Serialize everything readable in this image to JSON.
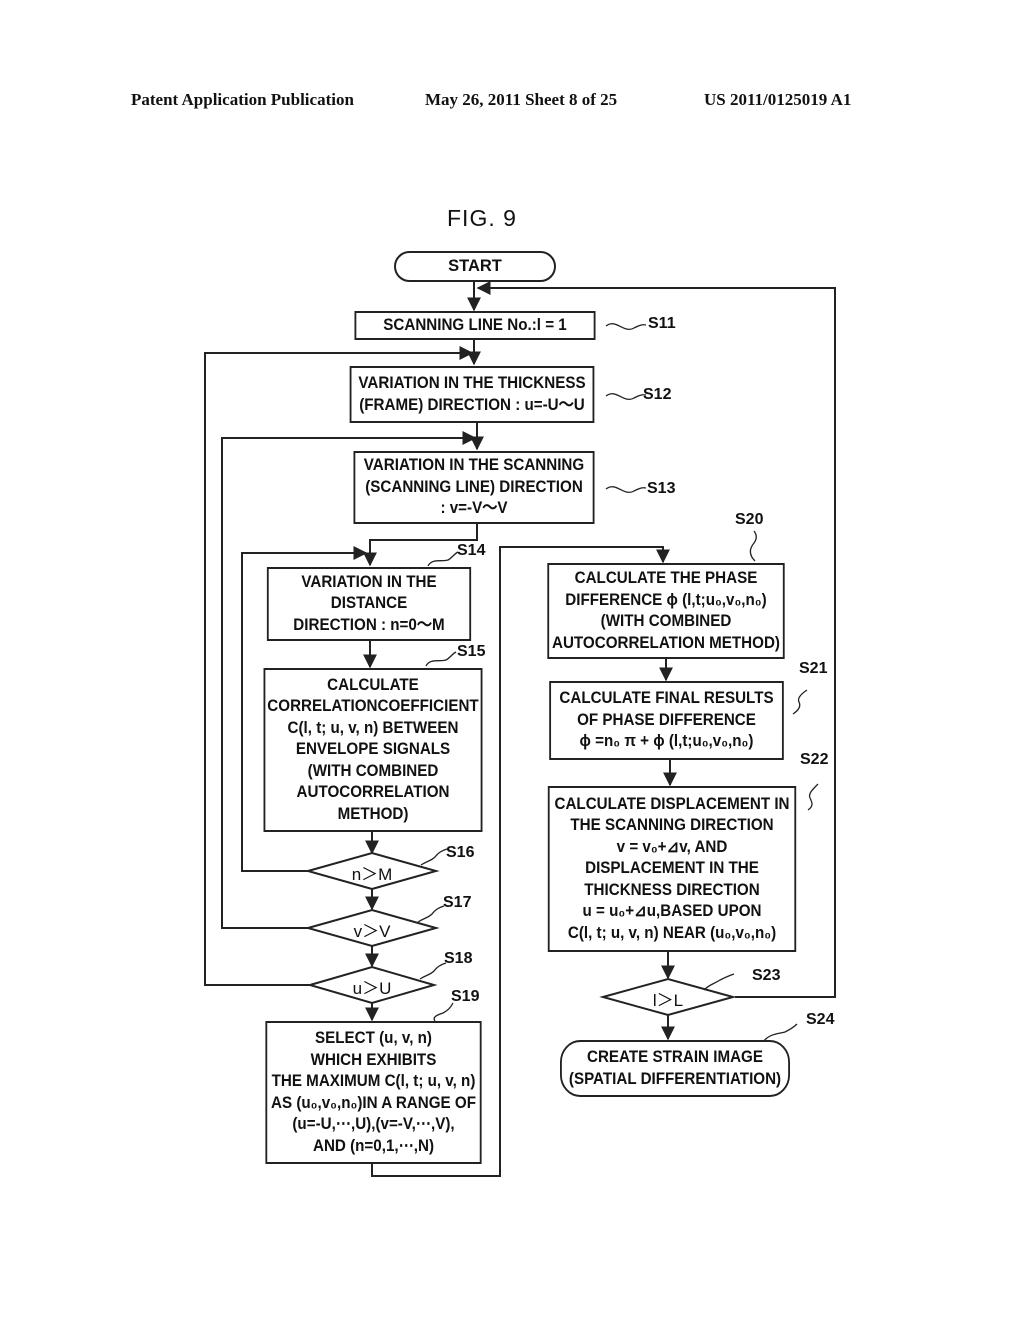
{
  "header": {
    "publication": "Patent Application Publication",
    "date_sheet": "May 26, 2011  Sheet 8 of 25",
    "number": "US 2011/0125019 A1"
  },
  "figure": {
    "title": "FIG. 9",
    "start": "START",
    "steps": {
      "S11": {
        "label": "S11",
        "text": "SCANNING LINE No.:l = 1"
      },
      "S12": {
        "label": "S12",
        "text": "VARIATION IN THE THICKNESS\n(FRAME) DIRECTION : u=-U～U"
      },
      "S13": {
        "label": "S13",
        "text": "VARIATION IN THE SCANNING\n(SCANNING LINE) DIRECTION\n: v=-V～V"
      },
      "S14": {
        "label": "S14",
        "text": "VARIATION IN THE\nDISTANCE\nDIRECTION : n=0～M"
      },
      "S15": {
        "label": "S15",
        "text": "CALCULATE\nCORRELATIONCOEFFICIENT\nC(l, t; u, v, n) BETWEEN\nENVELOPE SIGNALS\n(WITH COMBINED\nAUTOCORRELATION\nMETHOD)"
      },
      "S16": {
        "label": "S16",
        "text": "n＞M"
      },
      "S17": {
        "label": "S17",
        "text": "v＞V"
      },
      "S18": {
        "label": "S18",
        "text": "u＞U"
      },
      "S19": {
        "label": "S19",
        "text": "SELECT (u, v, n)\nWHICH EXHIBITS\nTHE MAXIMUM C(l, t; u, v, n)\nAS (u₀,v₀,n₀)IN A RANGE OF\n(u=-U,⋯,U),(v=-V,⋯,V),\nAND (n=0,1,⋯,N)"
      },
      "S20": {
        "label": "S20",
        "text": "CALCULATE THE PHASE\nDIFFERENCE ϕ (l,t;u₀,v₀,n₀)\n(WITH COMBINED\nAUTOCORRELATION METHOD)"
      },
      "S21": {
        "label": "S21",
        "text": "CALCULATE FINAL RESULTS\nOF PHASE DIFFERENCE\nϕ =n₀ π + ϕ (l,t;u₀,v₀,n₀)"
      },
      "S22": {
        "label": "S22",
        "text": "CALCULATE DISPLACEMENT IN\nTHE SCANNING DIRECTION\nv = v₀+⊿v,  AND\nDISPLACEMENT IN THE\nTHICKNESS DIRECTION\nu = u₀+⊿u,BASED UPON\nC(l, t; u, v, n) NEAR (u₀,v₀,n₀)"
      },
      "S23": {
        "label": "S23",
        "text": "l＞L"
      },
      "S24": {
        "label": "S24",
        "text": "CREATE STRAIN IMAGE\n(SPATIAL DIFFERENTIATION)"
      }
    }
  }
}
